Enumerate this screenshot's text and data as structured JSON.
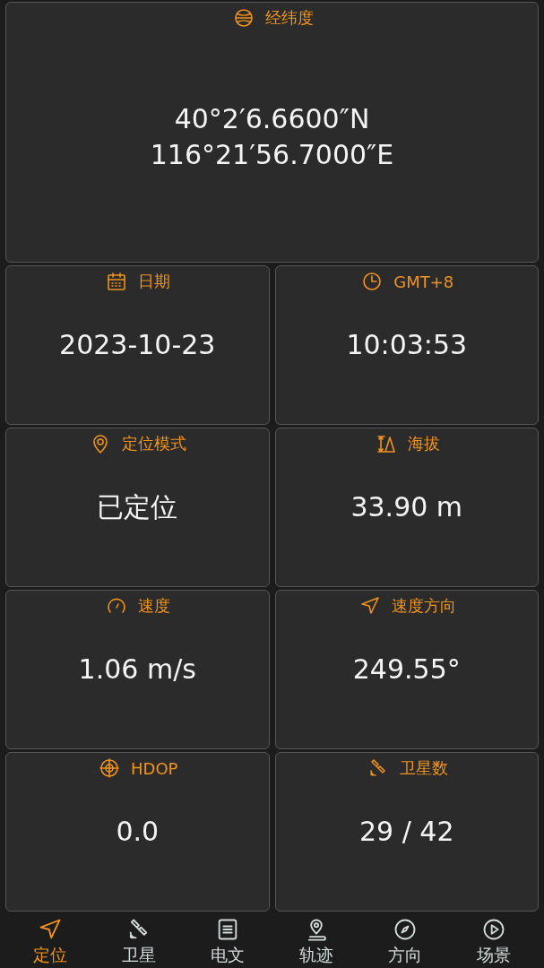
{
  "coordinates": {
    "label": "经纬度",
    "latitude": "40°2′6.6600″N",
    "longitude": "116°21′56.7000″E"
  },
  "cards": [
    {
      "label": "日期",
      "value": "2023-10-23"
    },
    {
      "label": "GMT+8",
      "value": "10:03:53"
    },
    {
      "label": "定位模式",
      "value": "已定位"
    },
    {
      "label": "海拔",
      "value": "33.90 m"
    },
    {
      "label": "速度",
      "value": "1.06 m/s"
    },
    {
      "label": "速度方向",
      "value": "249.55°"
    },
    {
      "label": "HDOP",
      "value": "0.0"
    },
    {
      "label": "卫星数",
      "value": "29 / 42"
    }
  ],
  "nav": [
    {
      "label": "定位",
      "selected": true
    },
    {
      "label": "卫星",
      "selected": false
    },
    {
      "label": "电文",
      "selected": false
    },
    {
      "label": "轨迹",
      "selected": false
    },
    {
      "label": "方向",
      "selected": false
    },
    {
      "label": "场景",
      "selected": false
    }
  ]
}
